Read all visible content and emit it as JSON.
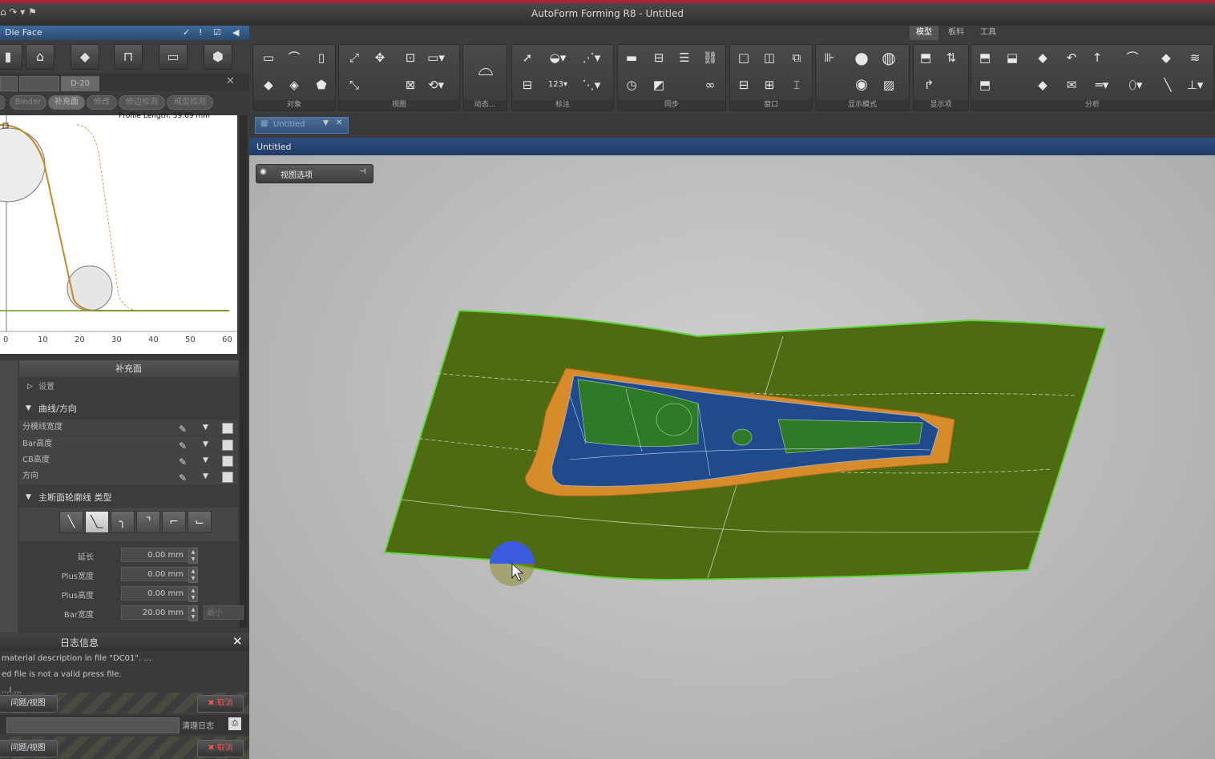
{
  "app": {
    "title": "AutoForm Forming R8 - Untitled",
    "quick_access": "⌂ ↷ ▾ ⚑"
  },
  "left_panel": {
    "header": "Die Face",
    "header_icons": [
      "✓",
      "!",
      "☑",
      "◀"
    ],
    "tab_active": "D-20",
    "pills": [
      "Binder",
      "补充面",
      "修改",
      "修边检测",
      "成型检测"
    ],
    "profile_length": "Profile Length: 59.69 mm",
    "x_ticks": [
      "0",
      "10",
      "20",
      "30",
      "40",
      "50",
      "60"
    ],
    "section_title": "补充面",
    "settings_label": "设置",
    "curves_group": "曲线/方向",
    "curve_rows": [
      "分模线宽度",
      "Bar高度",
      "CB高度",
      "方向"
    ],
    "profile_group": "主断面轮廓线 类型",
    "fields": [
      {
        "label": "延长",
        "value": "0.00 mm"
      },
      {
        "label": "Plus宽度",
        "value": "0.00 mm"
      },
      {
        "label": "Plus高度",
        "value": "0.00 mm"
      },
      {
        "label": "Bar宽度",
        "value": "20.00 mm",
        "unit": "最小"
      }
    ]
  },
  "log": {
    "title": "日志信息",
    "lines": [
      "material description in file \"DC01\". ...",
      "ed file is not a valid press file.",
      "...l  ..."
    ],
    "problem_view": "问题/视图",
    "cancel": "取消",
    "clear_log": "清理日志",
    "problem_view2": "问题/视图",
    "cancel2": "取消"
  },
  "ribbon": {
    "tabs": [
      "模型",
      "板料",
      "工具"
    ],
    "groups": [
      "对象",
      "视图",
      "动态...",
      "标注",
      "同步",
      "窗口",
      "显示模式",
      "显示项",
      "分析"
    ]
  },
  "document": {
    "tab_label": "Untitled",
    "title": "Untitled",
    "view_options": "视图选项"
  },
  "colors": {
    "accent": "#a7223a",
    "binder": "#4f6b12",
    "part_blue": "#1f4a8c",
    "part_green": "#2f7a26",
    "flange_orange": "#d88b2a"
  }
}
